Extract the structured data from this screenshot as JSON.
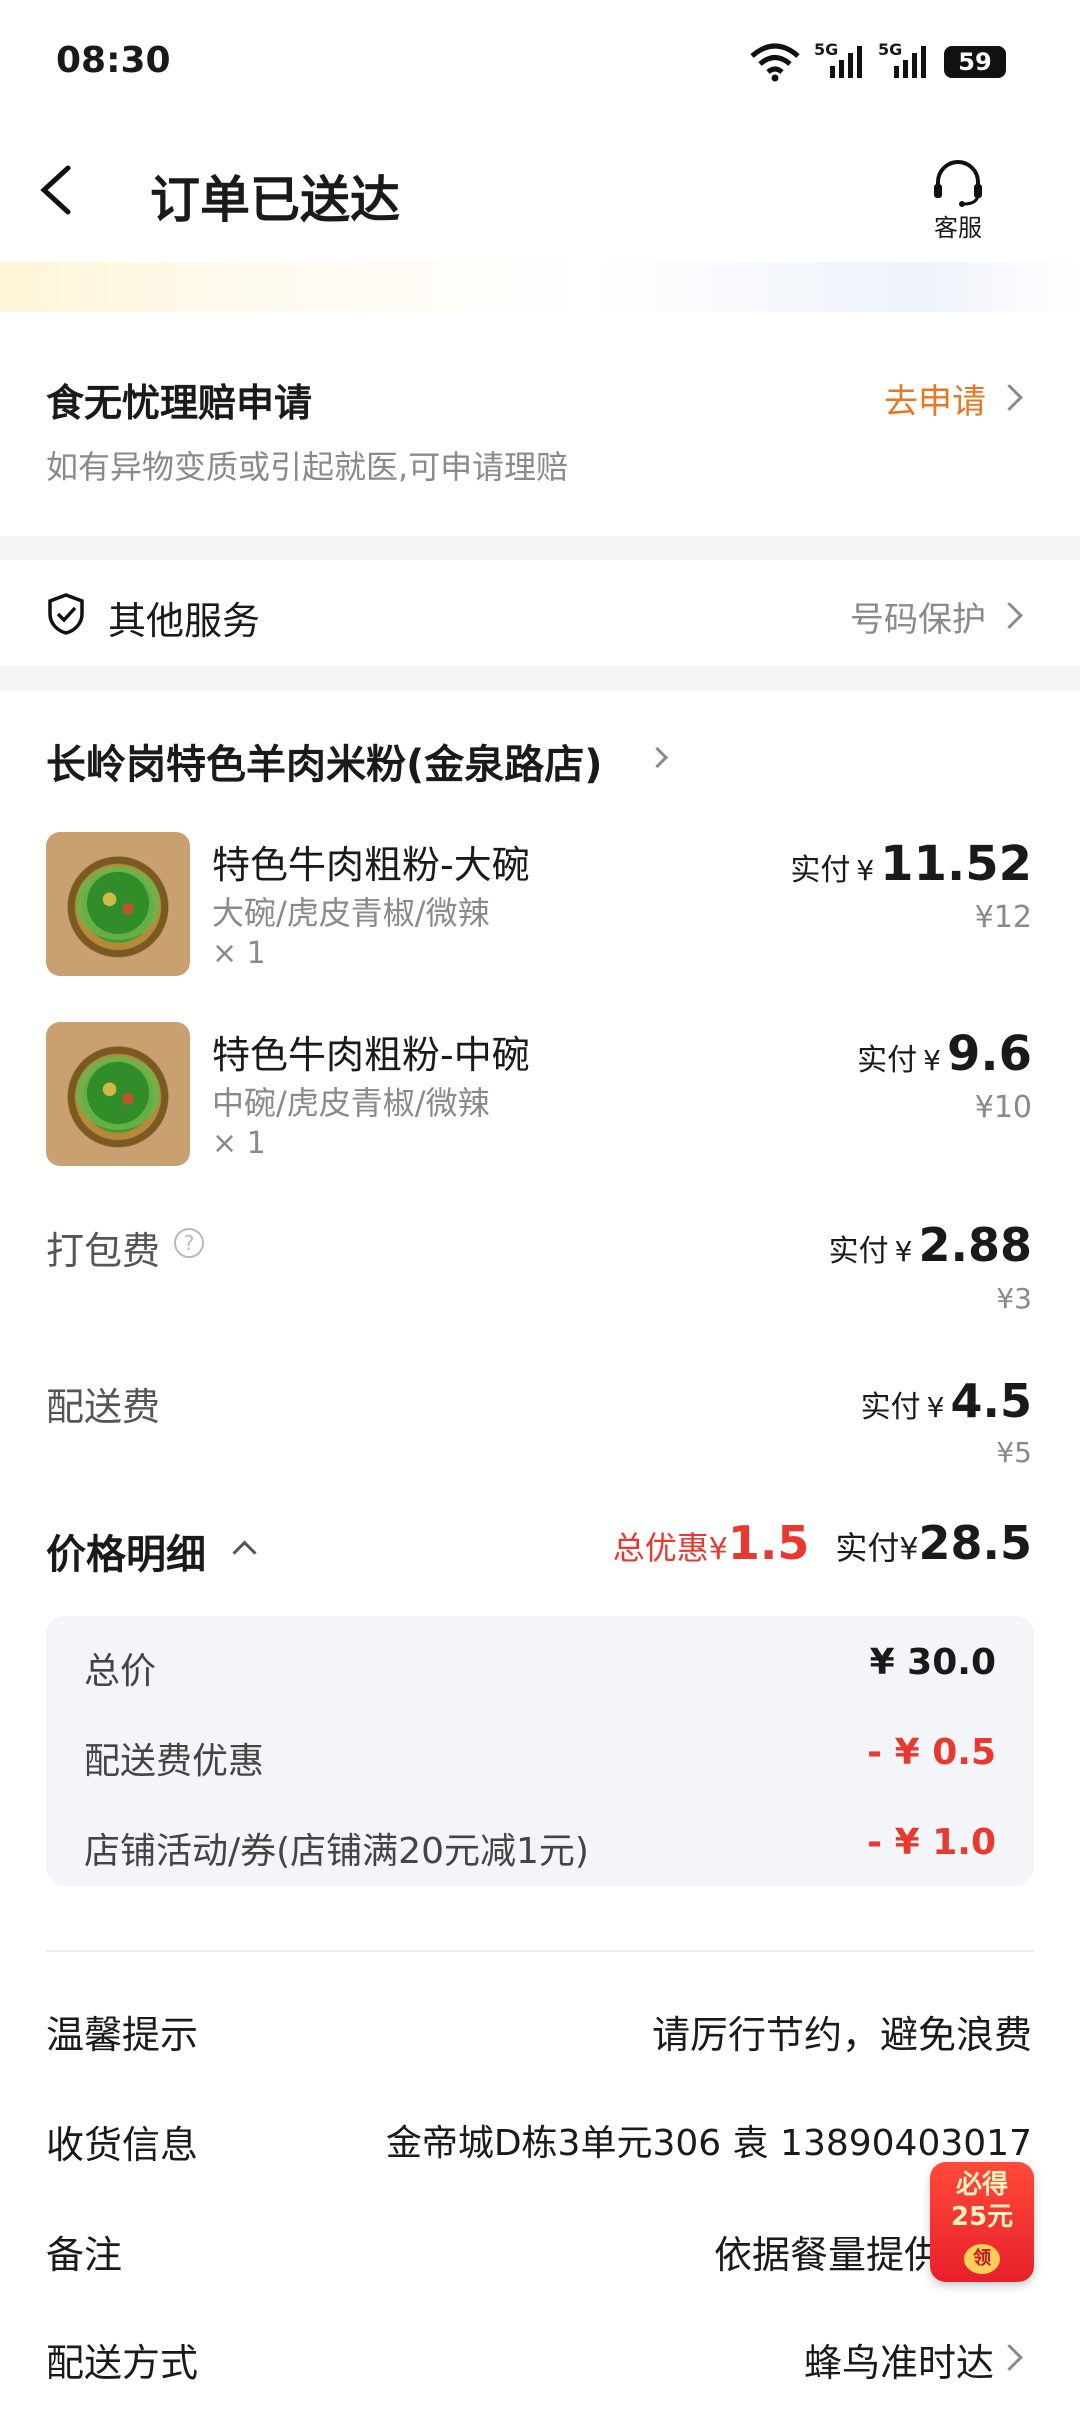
{
  "status_bar": {
    "time": "08:30",
    "battery": "59",
    "network1": "5G",
    "network2": "5G"
  },
  "header": {
    "title": "订单已送达",
    "service_label": "客服"
  },
  "claim": {
    "title": "食无忧理赔申请",
    "subtitle": "如有异物变质或引起就医,可申请理赔",
    "action": "去申请"
  },
  "services": {
    "label": "其他服务",
    "value": "号码保护"
  },
  "store": {
    "name": "长岭岗特色羊肉米粉(金泉路店)"
  },
  "items": [
    {
      "name": "特色牛肉粗粉-大碗",
      "spec": "大碗/虎皮青椒/微辣",
      "qty": "× 1",
      "paid_label": "实付",
      "currency": "¥",
      "paid": "11.52",
      "original": "¥12"
    },
    {
      "name": "特色牛肉粗粉-中碗",
      "spec": "中碗/虎皮青椒/微辣",
      "qty": "× 1",
      "paid_label": "实付",
      "currency": "¥",
      "paid": "9.6",
      "original": "¥10"
    }
  ],
  "fees": [
    {
      "label": "打包费",
      "has_help": true,
      "paid_label": "实付",
      "currency": "¥",
      "paid": "2.88",
      "original": "¥3"
    },
    {
      "label": "配送费",
      "has_help": false,
      "paid_label": "实付",
      "currency": "¥",
      "paid": "4.5",
      "original": "¥5"
    }
  ],
  "price_detail": {
    "title": "价格明细",
    "discount_label": "总优惠",
    "currency": "¥",
    "discount": "1.5",
    "paid_label": "实付",
    "paid": "28.5",
    "lines": [
      {
        "label": "总价",
        "value": "¥ 30.0",
        "negative": false
      },
      {
        "label": "配送费优惠",
        "value": "- ¥ 0.5",
        "negative": true
      },
      {
        "label": "店铺活动/券(店铺满20元减1元)",
        "value": "- ¥ 1.0",
        "negative": true
      }
    ]
  },
  "info": [
    {
      "label": "温馨提示",
      "value": "请厉行节约，避免浪费",
      "chevron": false
    },
    {
      "label": "收货信息",
      "value": "金帝城D栋3单元306 袁 13890403017",
      "chevron": false
    },
    {
      "label": "备注",
      "value": "依据餐量提供",
      "chevron": false
    },
    {
      "label": "配送方式",
      "value": "蜂鸟准时达",
      "chevron": true
    }
  ],
  "promo": {
    "line1": "必得",
    "line2": "25元",
    "badge": "领"
  },
  "colors": {
    "accent_orange": "#e87722",
    "discount_red": "#e8382f",
    "panel_bg": "#f3f5f9"
  }
}
